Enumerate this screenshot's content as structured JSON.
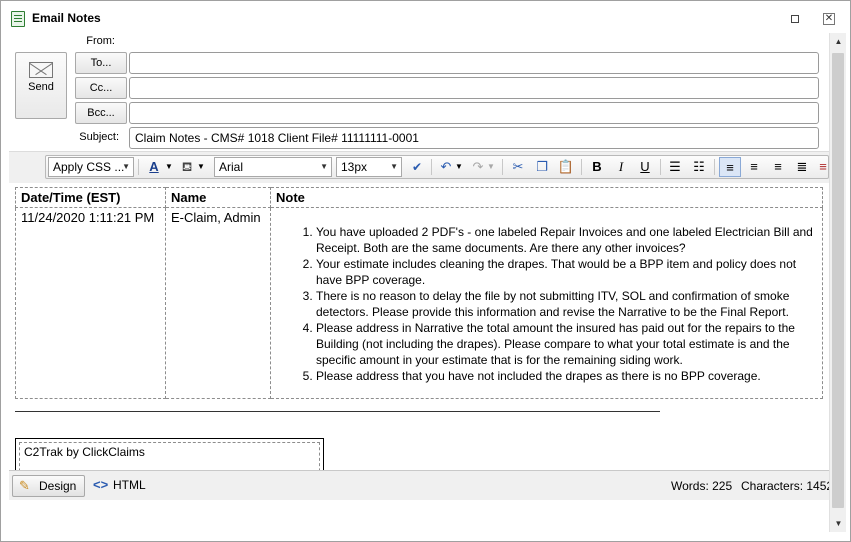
{
  "window": {
    "title": "Email Notes"
  },
  "header": {
    "send_label": "Send",
    "from_label": "From:",
    "to_label": "To...",
    "cc_label": "Cc...",
    "bcc_label": "Bcc...",
    "subject_label": "Subject:",
    "to_value": "",
    "cc_value": "",
    "bcc_value": "",
    "subject_value": "Claim Notes - CMS# 1018 Client File# 11111111-0001"
  },
  "toolbar": {
    "css_combo": "Apply CSS ...",
    "font_combo": "Arial",
    "size_combo": "13px"
  },
  "table": {
    "headers": [
      "Date/Time (EST)",
      "Name",
      "Note"
    ],
    "row": {
      "datetime": "11/24/2020 1:11:21 PM",
      "name": "E-Claim, Admin",
      "notes": [
        "You have uploaded 2 PDF's - one labeled Repair Invoices and one labeled Electrician Bill and Receipt. Both are the same documents.  Are there any other invoices?",
        "Your estimate includes cleaning the drapes.  That would be a BPP item and policy does not have BPP coverage.",
        "There is no reason to delay the file by not submitting ITV, SOL and confirmation of smoke detectors.  Please provide this information and revise the Narrative to be the Final Report.",
        "Please address in Narrative the total amount the insured has paid out for the repairs to the Building (not including the drapes).  Please compare to what your total estimate is and the specific amount in your estimate that is for the remaining siding work.",
        "Please address that you have not included the drapes as there is no BPP coverage."
      ]
    }
  },
  "footer_text": "C2Trak by ClickClaims",
  "bottom": {
    "design_label": "Design",
    "html_label": "HTML",
    "words": "Words: 225",
    "characters": "Characters: 1452"
  }
}
